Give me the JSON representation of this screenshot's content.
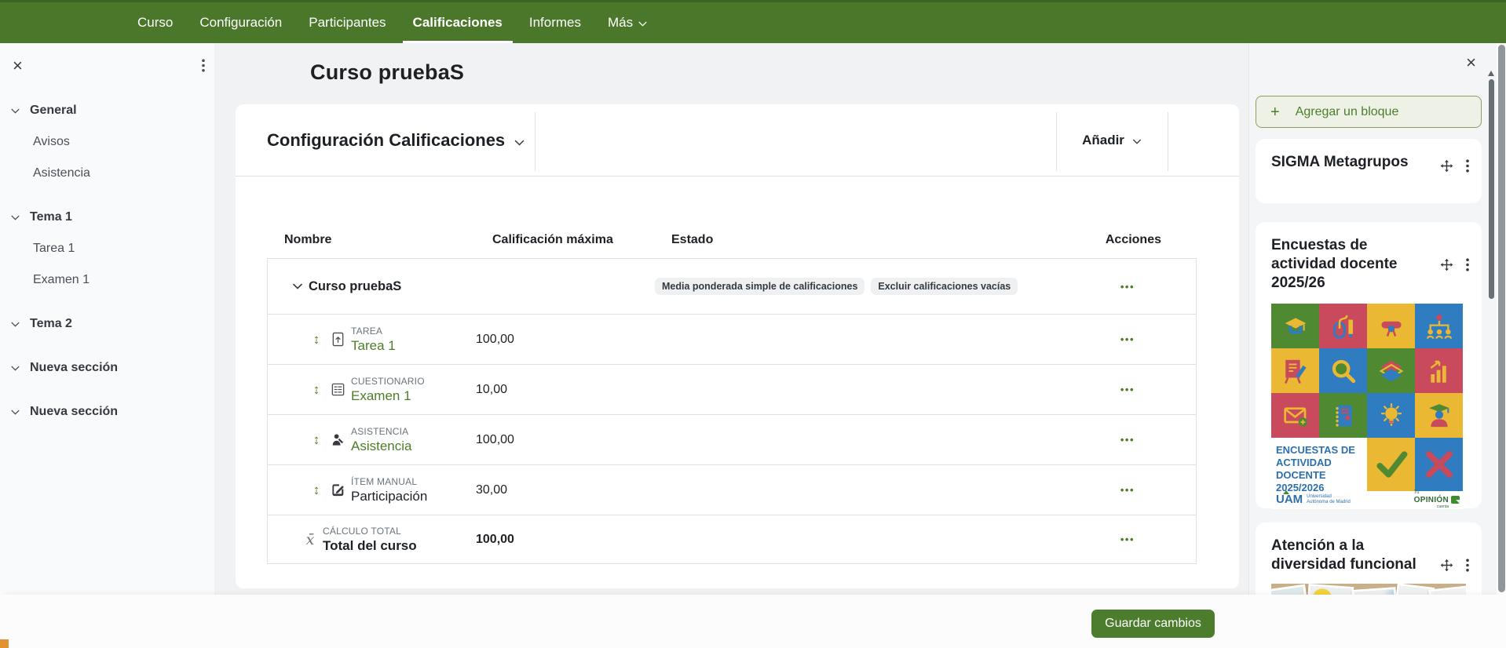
{
  "colors": {
    "nav_green": "#4a7729",
    "nav_green_dark": "#3c6420",
    "link_green": "#4c7e27",
    "button_green": "#4c7d2c",
    "page_bg": "#f1f2f3",
    "left_drawer_bg": "#f9fafb",
    "right_drawer_bg": "#f4f5f6",
    "card_bg": "#ffffff",
    "border": "#dee2e6",
    "text_dark": "#1d2125",
    "text_gray": "#6a737b",
    "badge_bg": "#eef0f2",
    "footer_bg": "#fcfcfd",
    "orange_accent": "#e2932f",
    "poster_green": "#4f8a33",
    "poster_red": "#c94a5c",
    "poster_yellow": "#eab832",
    "poster_blue": "#2f7cc0",
    "poster_text_blue": "#2c6fad"
  },
  "icons": {
    "close": "×",
    "move_vertical": "↕",
    "dots": "•••",
    "mean": "x̄",
    "plus": "+"
  },
  "topnav": {
    "items": [
      {
        "label": "Curso"
      },
      {
        "label": "Configuración"
      },
      {
        "label": "Participantes"
      },
      {
        "label": "Calificaciones",
        "active": true
      },
      {
        "label": "Informes"
      },
      {
        "label": "Más",
        "has_menu": true
      }
    ]
  },
  "left_drawer": {
    "items": [
      {
        "label": "General",
        "section": true
      },
      {
        "label": "Avisos"
      },
      {
        "label": "Asistencia"
      },
      {
        "label": "Tema 1",
        "section": true
      },
      {
        "label": "Tarea 1"
      },
      {
        "label": "Examen 1"
      },
      {
        "label": "Tema 2",
        "section": true
      },
      {
        "label": "Nueva sección",
        "section": true
      },
      {
        "label": "Nueva sección",
        "section": true
      }
    ]
  },
  "main": {
    "course_title": "Curso pruebaS",
    "view_selector": "Configuración Calificaciones",
    "add_button": "Añadir",
    "table": {
      "headers": [
        "Nombre",
        "Calificación máxima",
        "Estado",
        "Acciones"
      ],
      "course_row": {
        "name": "Curso pruebaS",
        "badges": [
          "Media ponderada simple de calificaciones",
          "Excluir calificaciones vacías"
        ]
      },
      "rows": [
        {
          "type_label": "TAREA",
          "name": "Tarea 1",
          "max": "100,00"
        },
        {
          "type_label": "CUESTIONARIO",
          "name": "Examen 1",
          "max": "10,00"
        },
        {
          "type_label": "ASISTENCIA",
          "name": "Asistencia",
          "max": "100,00"
        },
        {
          "type_label": "ÍTEM MANUAL",
          "name": "Participación",
          "max": "30,00"
        }
      ],
      "total_row": {
        "type_label": "CÁLCULO TOTAL",
        "name": "Total del curso",
        "max": "100,00"
      }
    }
  },
  "right_drawer": {
    "add_block_label": "Agregar un bloque",
    "blocks": [
      {
        "title": "SIGMA Metagrupos"
      },
      {
        "title": "Encuestas de actividad docente 2025/26"
      },
      {
        "title": "Atención a la diversidad funcional"
      }
    ],
    "poster": {
      "heading": "ENCUESTAS DE ACTIVIDAD DOCENTE 2025/2026",
      "uam_logo": "UAM",
      "uam_sub": "Universidad Autónoma de Madrid",
      "opinion_pre": "Tu",
      "opinion_logo": "OPINIÓN",
      "opinion_sub": "cuenta"
    }
  },
  "footer": {
    "save_button": "Guardar cambios"
  }
}
